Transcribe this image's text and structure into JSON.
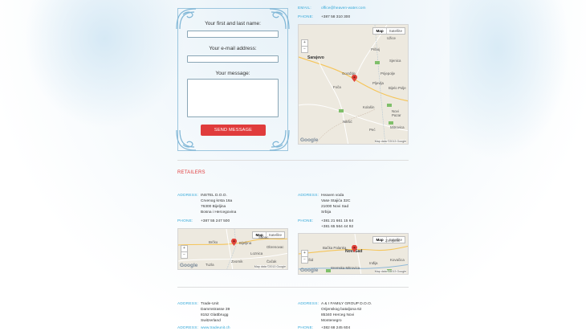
{
  "contact_form": {
    "name_label": "Your first and last name:",
    "email_label": "Your e-mail address:",
    "message_label": "Your message:",
    "send_label": "SEND MESSAGE"
  },
  "main_office": {
    "email_label": "EMAIL:",
    "email": "office@heaven-water.com",
    "phone_label": "PHONE:",
    "phone": "+387 58 310 300",
    "map": {
      "map_btn": "Map",
      "satellite_btn": "Satellite",
      "zoom_in": "+",
      "zoom_out": "−",
      "logo": "Google",
      "data": "Map data ©2013 Google",
      "places": [
        "Sarajevo",
        "Goražde",
        "Foča",
        "Pljevlja",
        "Bijelo Polje",
        "Prijepolje",
        "Sjenica",
        "Novi Pazar",
        "Priboj",
        "Mitrovica",
        "Nikšić",
        "Peć",
        "Kolašin",
        "Užice"
      ]
    }
  },
  "retailers": {
    "title": "RETAILERS",
    "address_label": "ADDRESS:",
    "phone_label": "PHONE:",
    "items": [
      {
        "lines": [
          "INSTEL D.O.O.",
          "Crvenog krsta 16a",
          "76300 Bijeljina",
          "Bosna i Hercegovina"
        ],
        "phones": [
          "+387 55 247 500"
        ],
        "map": {
          "map_btn": "Map",
          "satellite_btn": "Satellite",
          "zoom_in": "+",
          "zoom_out": "−",
          "logo": "Google",
          "data": "Map data ©2013 Google",
          "places": [
            "Bijeljina",
            "Brčko",
            "Šabac",
            "Tuzla",
            "Zvornik",
            "Loznica",
            "Obrenovac",
            "Čačak"
          ]
        }
      },
      {
        "lines": [
          "Heaven voda",
          "Vase Stajića 32C",
          "21000 Novi Sad",
          "Srbija"
        ],
        "phones": [
          "+381 21 661 15 64",
          "+381 65 564 44 92"
        ],
        "map": {
          "map_btn": "Map",
          "satellite_btn": "Satellite",
          "zoom_in": "+",
          "zoom_out": "−",
          "logo": "Google",
          "data": "Map data ©2013 Google",
          "places": [
            "Novi Sad",
            "Bačka Palanka",
            "Zrenjanin",
            "Sremska Mitrovica",
            "Kovačica",
            "Inđija",
            "Šid"
          ]
        }
      },
      {
        "lines": [
          "Trade-Unit",
          "Dammstrasse 39",
          "8152 Glattbrugg",
          "Switzerland"
        ],
        "phones": [
          "www.tradeunit.ch"
        ]
      },
      {
        "lines": [
          "A & I FAMILY GROUP D.O.O.",
          "Orijenskog bataljona 62",
          "85340 Herceg Novi",
          "Montenegro"
        ],
        "phones": [
          "+382 68 245 604"
        ]
      }
    ]
  }
}
